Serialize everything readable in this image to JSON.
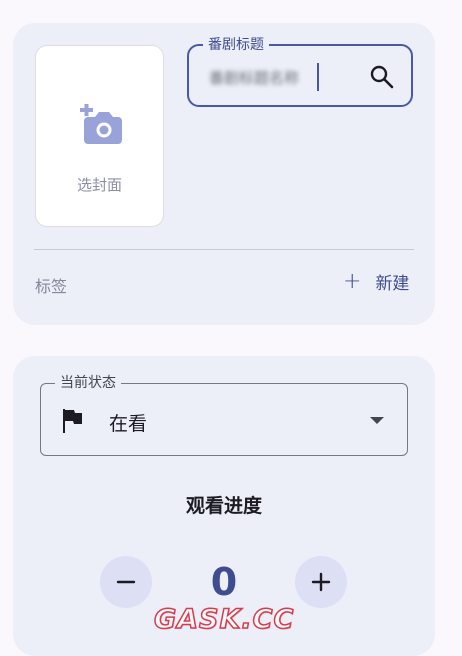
{
  "cover": {
    "label": "选封面",
    "icon": "add-photo-icon"
  },
  "title_field": {
    "label": "番剧标题",
    "value": "番剧标题名称"
  },
  "tags": {
    "label": "标签",
    "new_label": "新建"
  },
  "status": {
    "label": "当前状态",
    "value": "在看",
    "icon": "flag-icon"
  },
  "progress": {
    "title": "观看进度",
    "value": "0"
  },
  "watermark": "GASK.CC",
  "colors": {
    "accent": "#3f4c8f",
    "card_bg": "#eceef8",
    "page_bg": "#fbf8fd",
    "button_bg": "#dde0f5"
  }
}
